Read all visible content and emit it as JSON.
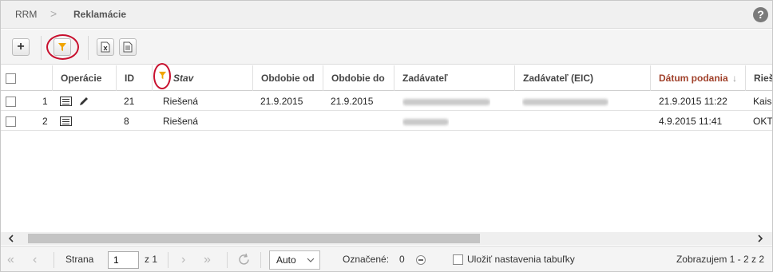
{
  "breadcrumb": {
    "root": "RRM",
    "separator": ">",
    "current": "Reklamácie"
  },
  "help": {
    "symbol": "?"
  },
  "toolbar": {
    "add_symbol": "+"
  },
  "columns": {
    "operacie": "Operácie",
    "id": "ID",
    "stav": "Stav",
    "obdobie_od": "Obdobie od",
    "obdobie_do": "Obdobie do",
    "zadavatel": "Zadávateľ",
    "zadavatel_eic": "Zadávateľ (EIC)",
    "datum_podania": "Dátum podania",
    "sort_arrow": "↓",
    "ries": "Rieš"
  },
  "rows": [
    {
      "num": "1",
      "id": "21",
      "stav": "Riešená",
      "od": "21.9.2015",
      "do": "21.9.2015",
      "datum": "21.9.2015 11:22",
      "ries": "Kais"
    },
    {
      "num": "2",
      "id": "8",
      "stav": "Riešená",
      "od": "",
      "do": "",
      "datum": "4.9.2015 11:41",
      "ries": "OKT"
    }
  ],
  "pager": {
    "page_label": "Strana",
    "page_value": "1",
    "of_label": "z 1",
    "size_value": "Auto",
    "marked_label": "Označené:",
    "marked_count": "0",
    "save_label": "Uložiť nastavenia tabuľky",
    "showing": "Zobrazujem 1 - 2 z 2"
  },
  "colors": {
    "accent_red": "#c8102e",
    "filter_orange": "#f0a400",
    "sorted_header": "#a0402a"
  }
}
